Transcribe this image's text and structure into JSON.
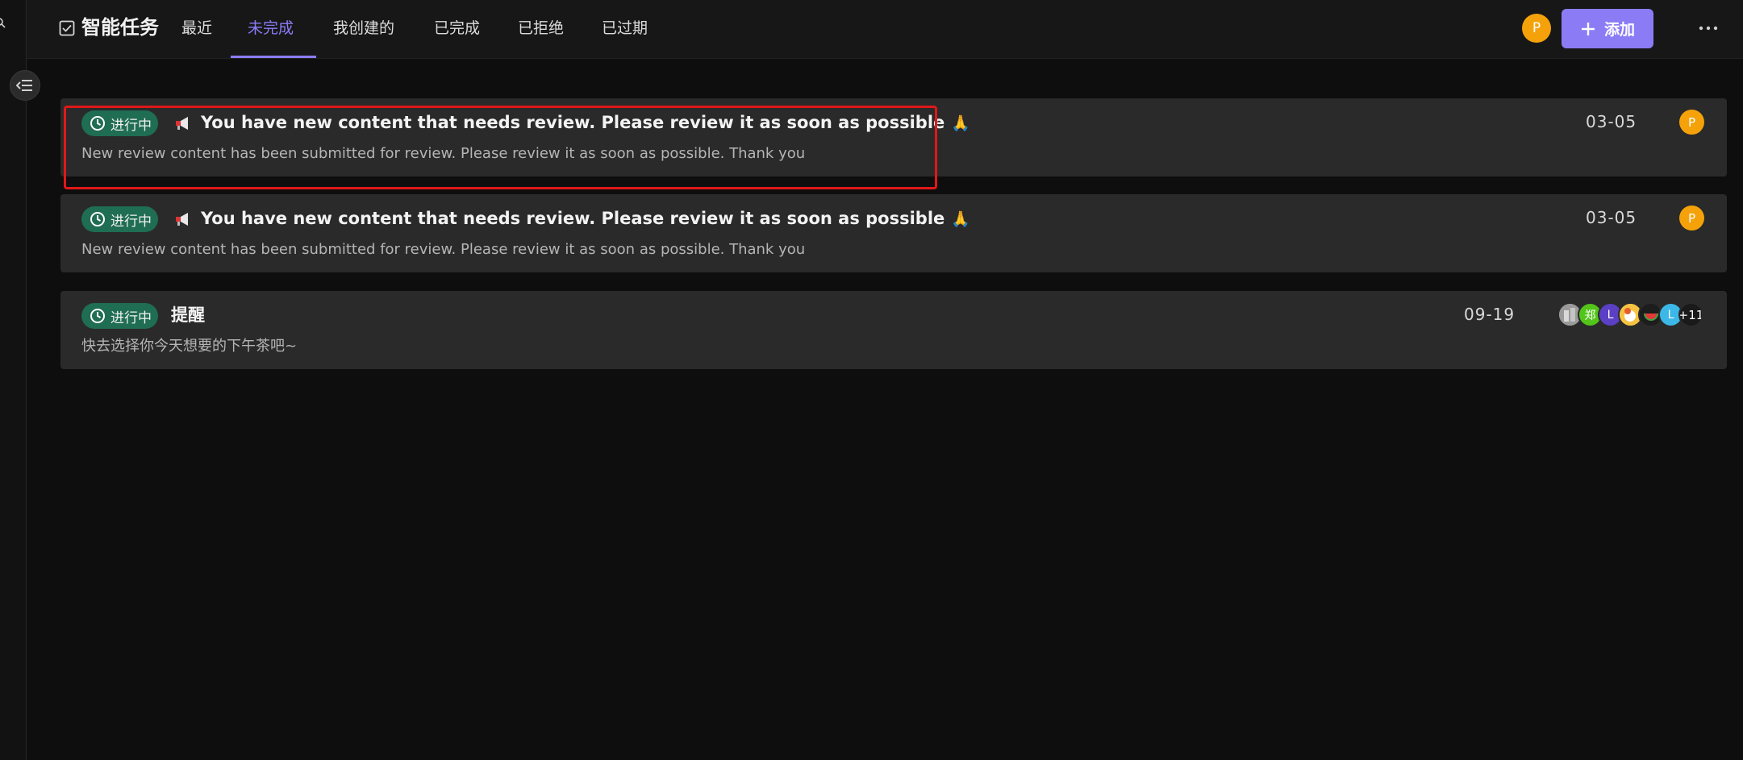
{
  "header": {
    "app_icon": "checkbox-icon",
    "title": "智能任务",
    "tabs": [
      {
        "label": "最近"
      },
      {
        "label": "未完成"
      },
      {
        "label": "我创建的"
      },
      {
        "label": "已完成"
      },
      {
        "label": "已拒绝"
      },
      {
        "label": "已过期"
      }
    ],
    "active_tab": "未完成",
    "user_avatar": "P",
    "add_button_label": "添加",
    "more_icon": "more-horizontal-icon"
  },
  "colors": {
    "accent": "#8b7cf6",
    "status_in_progress": "#1f6d52",
    "avatar_orange": "#f5a20a",
    "highlight": "#e01818"
  },
  "tasks": [
    {
      "status": "进行中",
      "icon": "megaphone-icon",
      "title": "You have new content that needs review. Please review it as soon as possible",
      "title_emoji": "🙏",
      "description": "New review content has been submitted for review. Please review it as soon as possible. Thank you",
      "date": "03-05",
      "assignee": "P"
    },
    {
      "status": "进行中",
      "icon": "megaphone-icon",
      "title": "You have new content that needs review. Please review it as soon as possible",
      "title_emoji": "🙏",
      "description": "New review content has been submitted for review. Please review it as soon as possible. Thank you",
      "date": "03-05",
      "assignee": "P"
    },
    {
      "status": "进行中",
      "title": "提醒",
      "description": "快去选择你今天想要的下午茶吧~",
      "date": "09-19",
      "assignees": [
        "",
        "郑",
        "L",
        "",
        "",
        "L"
      ],
      "assignees_more": "+11"
    }
  ]
}
